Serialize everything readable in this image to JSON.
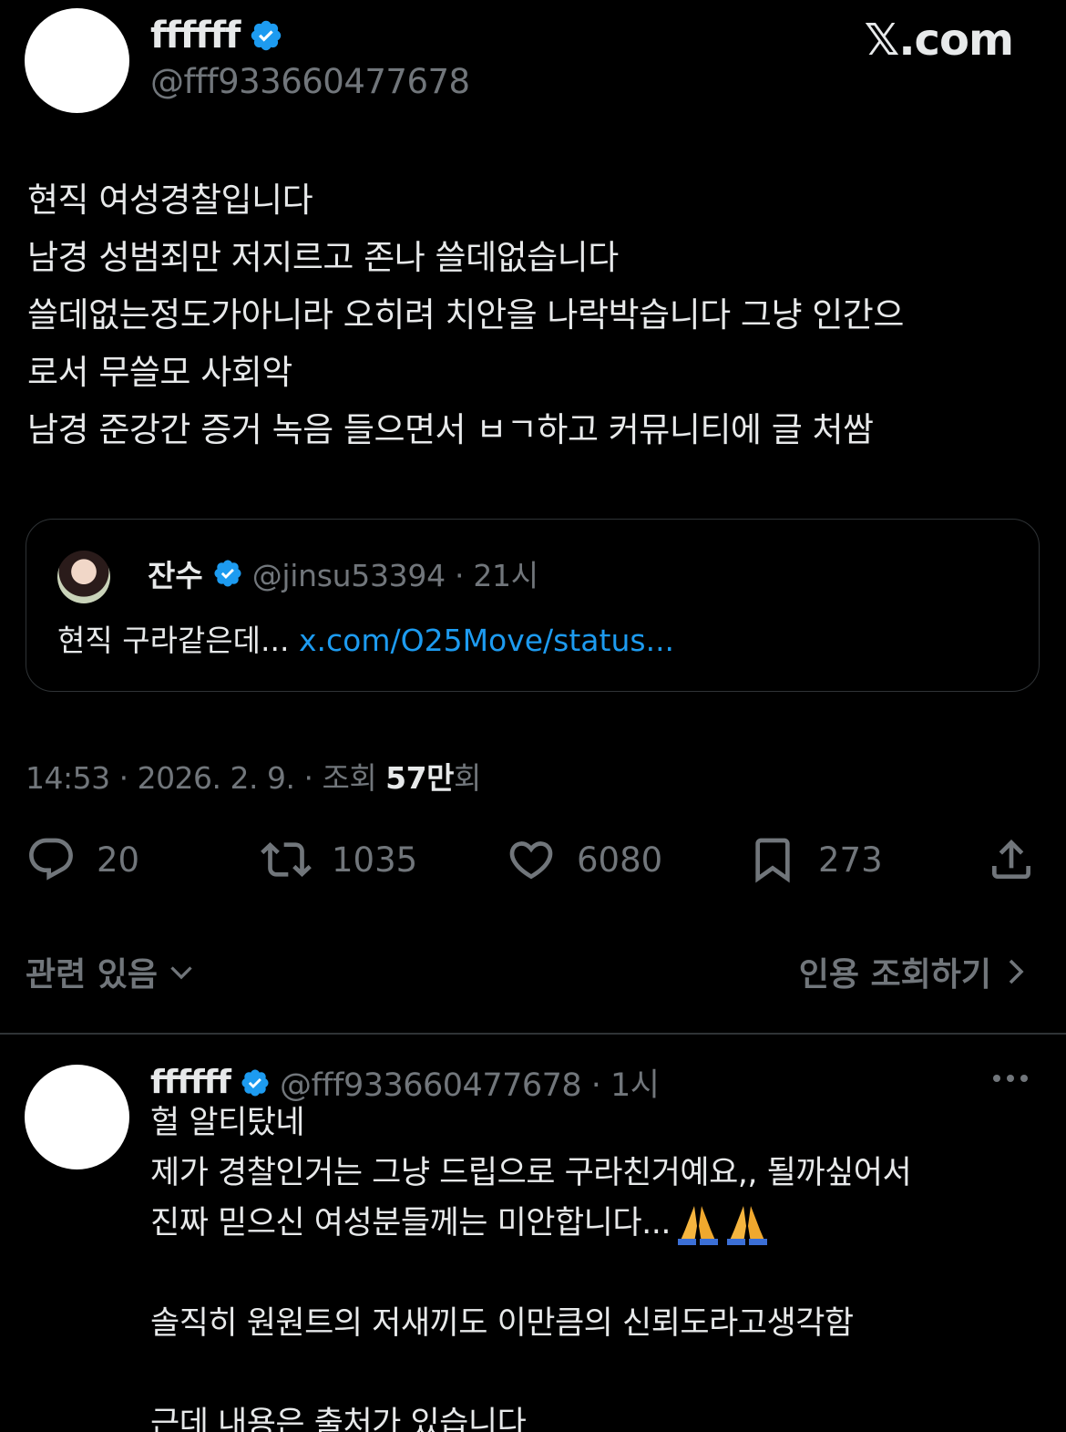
{
  "brand": "𝕏.com",
  "post": {
    "display_name": "ffffff",
    "handle": "@fff933660477678",
    "body": [
      "현직 여성경찰입니다",
      "남경 성범죄만 저지르고 존나 쓸데없습니다",
      "쓸데없는정도가아니라 오히려 치안을 나락박습니다 그냥 인간으",
      "로서 무쓸모 사회악",
      "남경 준강간 증거 녹음 들으면서 ㅂㄱ하고 커뮤니티에 글 처쌈"
    ],
    "quote": {
      "name": "잔수",
      "handle_time": "@jinsu53394 · 21시",
      "text": "현직 구라같은데...",
      "link": "x.com/O25Move/status..."
    },
    "meta": {
      "time_date": "14:53 · 2026. 2. 9. · 조회 ",
      "views": "57만",
      "views_suffix": "회"
    },
    "actions": {
      "replies": "20",
      "reposts": "1035",
      "likes": "6080",
      "bookmarks": "273"
    },
    "related_label": "관련 있음",
    "view_quotes_label": "인용 조회하기"
  },
  "reply": {
    "display_name": "ffffff",
    "handle_time": "@fff933660477678 · 1시",
    "lines": [
      "헐 알티탔네",
      "제가 경찰인거는 그냥 드립으로 구라친거예요,, 될까싶어서",
      "진짜 믿으신 여성분들께는 미안합니다...",
      "",
      "솔직히 원원트의 저새끼도 이만큼의 신뢰도라고생각함",
      "",
      "근데 내용은 출처가 있습니다"
    ]
  },
  "colors": {
    "background": "#000000",
    "text": "#e7e9ea",
    "muted": "#71767b",
    "link": "#1d9bf0",
    "verified": "#1d9bf0",
    "border": "#2f3336"
  }
}
